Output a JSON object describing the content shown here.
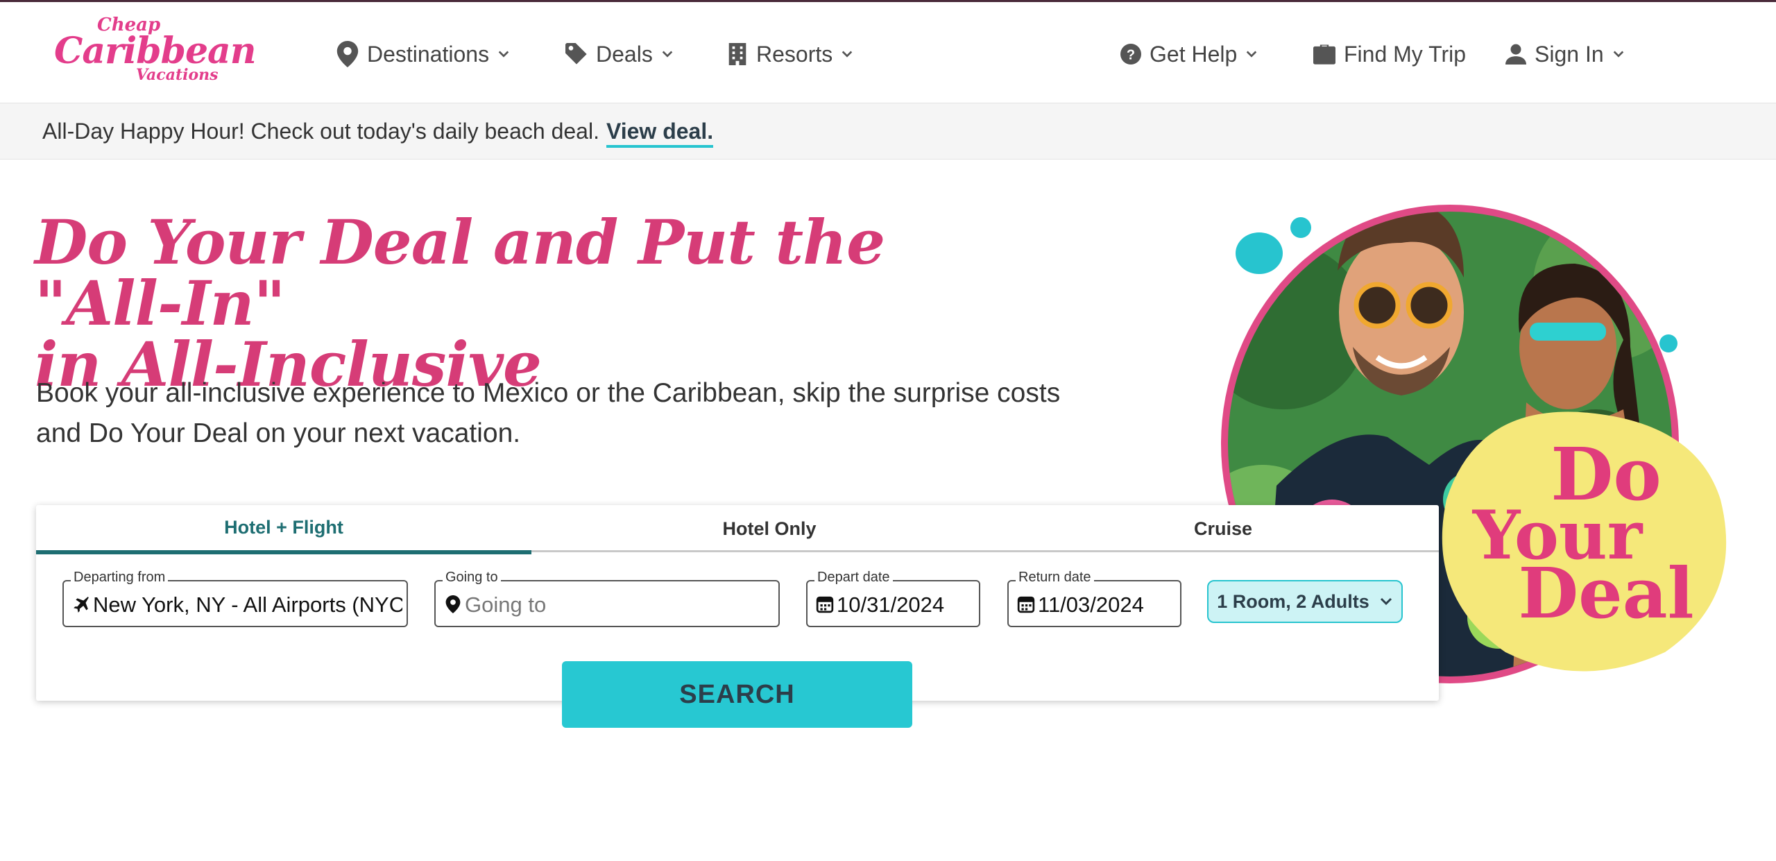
{
  "brand": {
    "logo_line1": "Cheap",
    "logo_line2": "Caribbean",
    "logo_line3": "Vacations",
    "primary_color": "#d63c77",
    "accent_color": "#27c8d2"
  },
  "nav": {
    "left": [
      {
        "label": "Destinations",
        "icon": "map-pin-icon"
      },
      {
        "label": "Deals",
        "icon": "tag-icon"
      },
      {
        "label": "Resorts",
        "icon": "building-icon"
      }
    ],
    "right": [
      {
        "label": "Get Help",
        "icon": "question-circle-icon"
      },
      {
        "label": "Find My Trip",
        "icon": "suitcase-icon"
      },
      {
        "label": "Sign In",
        "icon": "user-icon"
      }
    ]
  },
  "promo": {
    "text": "All-Day Happy Hour! Check out today's daily beach deal.",
    "link": "View deal."
  },
  "hero": {
    "title_line1": "Do Your Deal and Put the \"All-In\"",
    "title_line2": "in All-Inclusive",
    "subtitle_line1": "Book your all-inclusive experience to Mexico or the Caribbean, skip the surprise costs",
    "subtitle_line2": "and Do Your Deal on your next vacation.",
    "badge_line1": "Do",
    "badge_line2": "Your",
    "badge_line3": "Deal"
  },
  "search": {
    "tabs": [
      "Hotel + Flight",
      "Hotel Only",
      "Cruise"
    ],
    "active_tab": "Hotel + Flight",
    "departing": {
      "label": "Departing from",
      "value": "New York, NY - All Airports (NYC)"
    },
    "going": {
      "label": "Going to",
      "placeholder": "Going to"
    },
    "depart_date": {
      "label": "Depart date",
      "value": "10/31/2024"
    },
    "return_date": {
      "label": "Return date",
      "value": "11/03/2024"
    },
    "rooms": "1 Room, 2 Adults",
    "button": "SEARCH"
  }
}
